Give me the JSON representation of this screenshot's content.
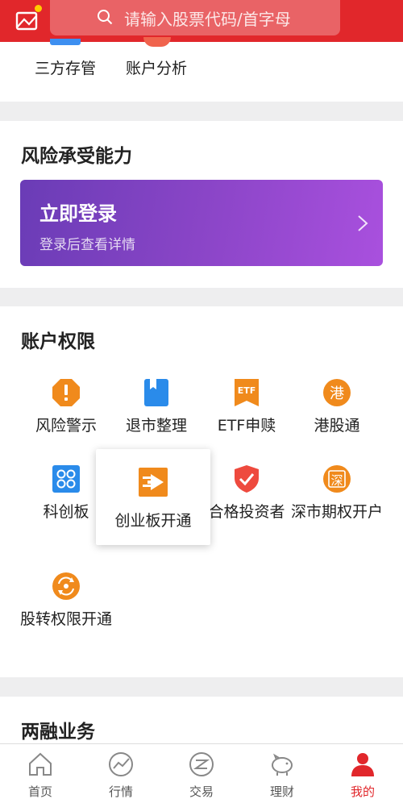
{
  "search": {
    "placeholder": "请输入股票代码/首字母"
  },
  "top_items": [
    {
      "label": "三方存管"
    },
    {
      "label": "账户分析"
    }
  ],
  "risk": {
    "title": "风险承受能力",
    "banner_title": "立即登录",
    "banner_subtitle": "登录后查看详情"
  },
  "permissions": {
    "title": "账户权限",
    "items": [
      {
        "label": "风险警示",
        "icon": "warning-icon"
      },
      {
        "label": "退市整理",
        "icon": "bookmark-icon"
      },
      {
        "label": "ETF申赎",
        "icon": "etf-icon"
      },
      {
        "label": "港股通",
        "icon": "hk-icon"
      },
      {
        "label": "科创板",
        "icon": "star-market-icon"
      },
      {
        "label": "合格投资者",
        "icon": "shield-check-icon"
      },
      {
        "label": "深市期权开户",
        "icon": "shen-icon"
      },
      {
        "label": "股转权限开通",
        "icon": "transfer-icon"
      }
    ],
    "popover_label": "创业板开通"
  },
  "margin": {
    "title": "两融业务"
  },
  "nav": [
    {
      "label": "首页",
      "icon": "home-icon"
    },
    {
      "label": "行情",
      "icon": "chart-icon"
    },
    {
      "label": "交易",
      "icon": "trade-icon"
    },
    {
      "label": "理财",
      "icon": "piggy-icon"
    },
    {
      "label": "我的",
      "icon": "user-icon"
    }
  ],
  "colors": {
    "brand_red": "#e1272b",
    "orange": "#f08a1c",
    "purple_start": "#6a3cb6",
    "purple_end": "#a950de"
  }
}
